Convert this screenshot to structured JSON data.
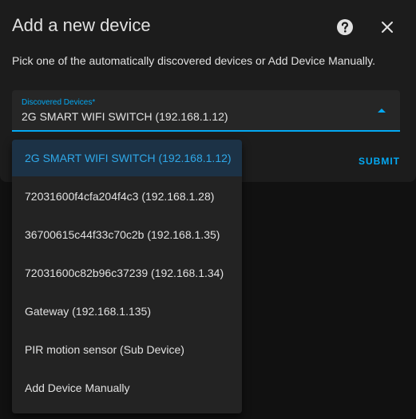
{
  "dialog": {
    "title": "Add a new device",
    "help_icon": "help-circle-icon",
    "close_icon": "close-icon",
    "description": "Pick one of the automatically discovered devices or Add Device Manually.",
    "submit_label": "SUBMIT"
  },
  "select": {
    "label": "Discovered Devices*",
    "value": "2G SMART WIFI SWITCH (192.168.1.12)",
    "expanded": true
  },
  "options": [
    {
      "label": "2G SMART WIFI SWITCH (192.168.1.12)",
      "selected": true
    },
    {
      "label": "72031600f4cfa204f4c3 (192.168.1.28)",
      "selected": false
    },
    {
      "label": "36700615c44f33c70c2b (192.168.1.35)",
      "selected": false
    },
    {
      "label": "72031600c82b96c37239 (192.168.1.34)",
      "selected": false
    },
    {
      "label": "Gateway (192.168.1.135)",
      "selected": false
    },
    {
      "label": "PIR motion sensor (Sub Device)",
      "selected": false
    },
    {
      "label": "Add Device Manually",
      "selected": false
    }
  ],
  "colors": {
    "accent": "#03a9f4",
    "background": "#111111",
    "dialog": "#1c1c1c",
    "text": "#e1e1e1",
    "selected_bg": "#1c3246"
  }
}
